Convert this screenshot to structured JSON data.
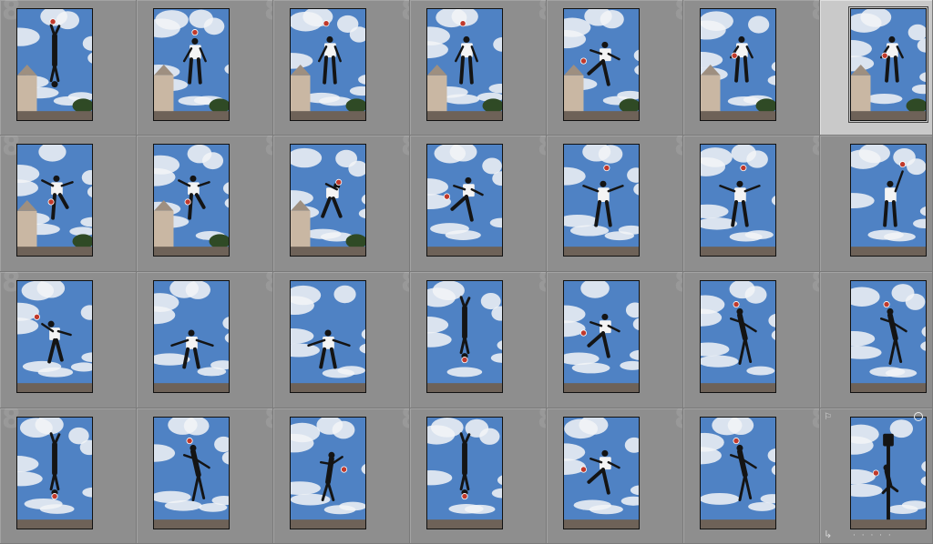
{
  "app": {
    "view": "grid"
  },
  "grid": {
    "columns": 7,
    "rows": 4,
    "selected_index": 6,
    "cells": [
      {
        "index": "8",
        "pose": "handstand-ball-feet",
        "building": true
      },
      {
        "index": "8",
        "pose": "stand-ball-head",
        "building": true
      },
      {
        "index": "8",
        "pose": "stand-ball-above",
        "building": true
      },
      {
        "index": "8",
        "pose": "stand-ball-above",
        "building": true
      },
      {
        "index": "8",
        "pose": "kick-ball-left",
        "building": true
      },
      {
        "index": "8",
        "pose": "stand-ball-chest",
        "building": true
      },
      {
        "index": "8",
        "pose": "stand-ball-chest",
        "building": true
      },
      {
        "index": "8",
        "pose": "knee-ball",
        "building": true
      },
      {
        "index": "8",
        "pose": "knee-ball",
        "building": true
      },
      {
        "index": "8",
        "pose": "bend-head",
        "building": true
      },
      {
        "index": "8",
        "pose": "kick-ball-left",
        "building": false
      },
      {
        "index": "8",
        "pose": "arms-out-ball-above",
        "building": false
      },
      {
        "index": "8",
        "pose": "arms-out-ball-above",
        "building": false
      },
      {
        "index": "8",
        "pose": "arm-up-ball",
        "building": false
      },
      {
        "index": "8",
        "pose": "lean-ball-left",
        "building": false
      },
      {
        "index": "8",
        "pose": "arms-out",
        "building": false
      },
      {
        "index": "8",
        "pose": "arms-out",
        "building": false
      },
      {
        "index": "8",
        "pose": "handstand",
        "building": false
      },
      {
        "index": "8",
        "pose": "kick-ball-left",
        "building": false
      },
      {
        "index": "8",
        "pose": "lean-ball-head",
        "building": false
      },
      {
        "index": "8",
        "pose": "lean-ball-head",
        "building": false
      },
      {
        "index": "8",
        "pose": "handstand",
        "building": false
      },
      {
        "index": "8",
        "pose": "lean-ball-head",
        "building": false
      },
      {
        "index": "8",
        "pose": "bend-ball-right",
        "building": false
      },
      {
        "index": "8",
        "pose": "handstand",
        "building": false
      },
      {
        "index": "8",
        "pose": "kick-ball-left",
        "building": false
      },
      {
        "index": "8",
        "pose": "lean-ball-head",
        "building": false
      },
      {
        "index": "8",
        "pose": "lamp-post",
        "building": false
      }
    ],
    "last_cell_icons": {
      "flag": "⚐",
      "rotate": "↳",
      "dots": "· · · · ·"
    }
  },
  "colors": {
    "sky": "#4f82c4",
    "cloud": "#f2f4f7",
    "silhouette": "#141414",
    "stone": "#6e6258",
    "building": "#c9b7a3",
    "ball": "#c0392b",
    "shirt": "#f4f4f4"
  }
}
